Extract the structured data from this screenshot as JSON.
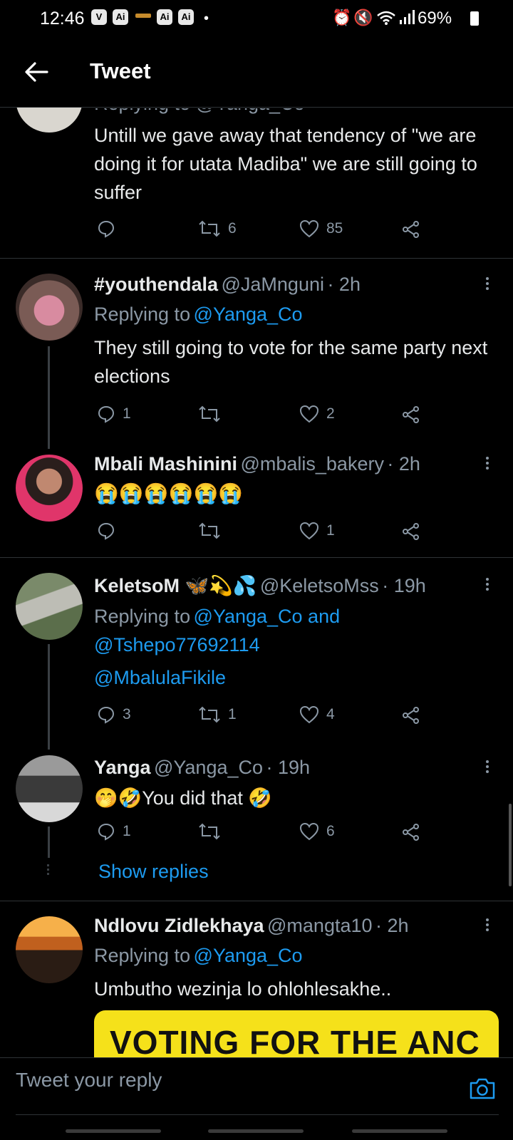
{
  "status_bar": {
    "time": "12:46",
    "left_icons": [
      "V",
      "Ai",
      "Ai",
      "Ai"
    ],
    "battery": "69%",
    "right_icons": [
      "alarm-icon",
      "mute-icon",
      "wifi-icon",
      "signal-icon",
      "battery-icon"
    ]
  },
  "header": {
    "title": "Tweet"
  },
  "top_tweet": {
    "replying_to": "Replying to @Yanga_Co",
    "text": "Untill we gave away that tendency of \"we are doing it for utata Madiba\" we are still going to suffer",
    "retweets": "6",
    "likes": "85"
  },
  "tweets": [
    {
      "name": "#youthendala",
      "handle": "@JaMnguni",
      "time": "· 2h",
      "replying_prefix": "Replying to",
      "replying_to": "@Yanga_Co",
      "text": "They still going to vote for the same party next elections",
      "replies": "1",
      "retweets": "",
      "likes": "2"
    },
    {
      "name": "Mbali Mashinini",
      "handle": "@mbalis_bakery",
      "time": "· 2h",
      "text": "😭😭😭😭😭😭",
      "replies": "",
      "retweets": "",
      "likes": "1"
    },
    {
      "name": "KeletsoM 🦋💫💦",
      "handle": "@KeletsoMss",
      "time": "· 19h",
      "replying_prefix": "Replying to",
      "replying_to": "@Yanga_Co and",
      "replying_to_2": "@Tshepo77692114",
      "text_link": "@MbalulaFikile",
      "replies": "3",
      "retweets": "1",
      "likes": "4"
    },
    {
      "name": "Yanga",
      "handle": "@Yanga_Co",
      "time": "· 19h",
      "text": "🤭🤣You did that 🤣",
      "replies": "1",
      "retweets": "",
      "likes": "6"
    },
    {
      "name": "Ndlovu Zidlekhaya",
      "handle": "@mangta10",
      "time": "· 2h",
      "replying_prefix": "Replying to",
      "replying_to": "@Yanga_Co",
      "text": "Umbutho wezinja lo ohlohlesakhe..",
      "image_text": "VOTING FOR THE ANC"
    }
  ],
  "show_replies": "Show replies",
  "reply_bar": {
    "placeholder": "Tweet your reply"
  },
  "colors": {
    "accent": "#1d9bf0",
    "background": "#000000",
    "secondary_text": "#8b98a5",
    "divider": "#2f3336"
  }
}
